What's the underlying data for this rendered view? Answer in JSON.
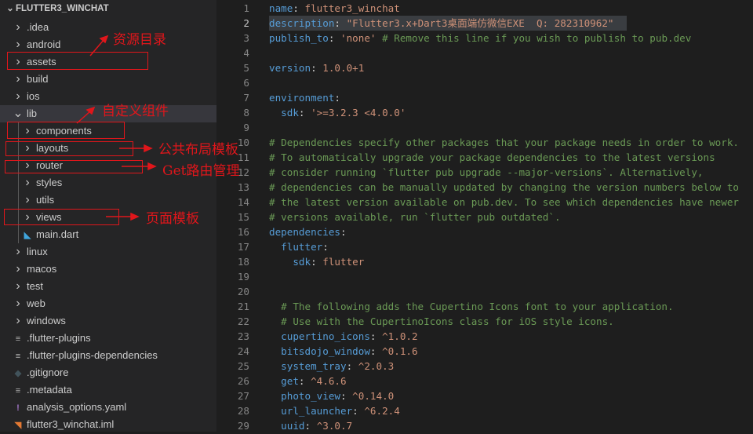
{
  "explorer": {
    "root": "FLUTTER3_WINCHAT",
    "items": [
      {
        "label": ".idea",
        "type": "folder",
        "depth": 0
      },
      {
        "label": "android",
        "type": "folder",
        "depth": 0
      },
      {
        "label": "assets",
        "type": "folder",
        "depth": 0
      },
      {
        "label": "build",
        "type": "folder",
        "depth": 0
      },
      {
        "label": "ios",
        "type": "folder",
        "depth": 0
      },
      {
        "label": "lib",
        "type": "folder-open",
        "depth": 0,
        "selected": true
      },
      {
        "label": "components",
        "type": "folder",
        "depth": 1
      },
      {
        "label": "layouts",
        "type": "folder",
        "depth": 1
      },
      {
        "label": "router",
        "type": "folder",
        "depth": 1
      },
      {
        "label": "styles",
        "type": "folder",
        "depth": 1
      },
      {
        "label": "utils",
        "type": "folder",
        "depth": 1
      },
      {
        "label": "views",
        "type": "folder",
        "depth": 1
      },
      {
        "label": "main.dart",
        "type": "dart-file",
        "depth": 1
      },
      {
        "label": "linux",
        "type": "folder",
        "depth": 0
      },
      {
        "label": "macos",
        "type": "folder",
        "depth": 0
      },
      {
        "label": "test",
        "type": "folder",
        "depth": 0
      },
      {
        "label": "web",
        "type": "folder",
        "depth": 0
      },
      {
        "label": "windows",
        "type": "folder",
        "depth": 0
      },
      {
        "label": ".flutter-plugins",
        "type": "text-file",
        "depth": 0
      },
      {
        "label": ".flutter-plugins-dependencies",
        "type": "text-file",
        "depth": 0
      },
      {
        "label": ".gitignore",
        "type": "git-file",
        "depth": 0
      },
      {
        "label": ".metadata",
        "type": "text-file",
        "depth": 0
      },
      {
        "label": "analysis_options.yaml",
        "type": "yaml-file",
        "depth": 0
      },
      {
        "label": "flutter3_winchat.iml",
        "type": "rss-file",
        "depth": 0
      }
    ]
  },
  "annotations": {
    "assets": "资源目录",
    "components": "自定义组件",
    "layouts": "公共布局模板",
    "router": "Get路由管理",
    "views": "页面模板"
  },
  "editor": {
    "current_line": 2,
    "lines": [
      [
        [
          "k",
          "name"
        ],
        [
          "p",
          ": "
        ],
        [
          "s",
          "flutter3_winchat"
        ]
      ],
      [
        [
          "k",
          "description"
        ],
        [
          "p",
          ": "
        ],
        [
          "s",
          "\"Flutter3.x+Dart3桌面端仿微信EXE  Q: 282310962\""
        ]
      ],
      [
        [
          "k",
          "publish_to"
        ],
        [
          "p",
          ": "
        ],
        [
          "s",
          "'none'"
        ],
        [
          "c",
          " # Remove this line if you wish to publish to pub.dev"
        ]
      ],
      [],
      [
        [
          "k",
          "version"
        ],
        [
          "p",
          ": "
        ],
        [
          "n",
          "1.0.0+1"
        ]
      ],
      [],
      [
        [
          "k",
          "environment"
        ],
        [
          "p",
          ":"
        ]
      ],
      [
        [
          "p",
          "  "
        ],
        [
          "k",
          "sdk"
        ],
        [
          "p",
          ": "
        ],
        [
          "s",
          "'>=3.2.3 <4.0.0'"
        ]
      ],
      [],
      [
        [
          "c",
          "# Dependencies specify other packages that your package needs in order to work."
        ]
      ],
      [
        [
          "c",
          "# To automatically upgrade your package dependencies to the latest versions"
        ]
      ],
      [
        [
          "c",
          "# consider running `flutter pub upgrade --major-versions`. Alternatively,"
        ]
      ],
      [
        [
          "c",
          "# dependencies can be manually updated by changing the version numbers below to"
        ]
      ],
      [
        [
          "c",
          "# the latest version available on pub.dev. To see which dependencies have newer"
        ]
      ],
      [
        [
          "c",
          "# versions available, run `flutter pub outdated`."
        ]
      ],
      [
        [
          "k",
          "dependencies"
        ],
        [
          "p",
          ":"
        ]
      ],
      [
        [
          "p",
          "  "
        ],
        [
          "k",
          "flutter"
        ],
        [
          "p",
          ":"
        ]
      ],
      [
        [
          "p",
          "    "
        ],
        [
          "k",
          "sdk"
        ],
        [
          "p",
          ": "
        ],
        [
          "s",
          "flutter"
        ]
      ],
      [],
      [],
      [
        [
          "c",
          "  # The following adds the Cupertino Icons font to your application."
        ]
      ],
      [
        [
          "c",
          "  # Use with the CupertinoIcons class for iOS style icons."
        ]
      ],
      [
        [
          "p",
          "  "
        ],
        [
          "k",
          "cupertino_icons"
        ],
        [
          "p",
          ": "
        ],
        [
          "n",
          "^1.0.2"
        ]
      ],
      [
        [
          "p",
          "  "
        ],
        [
          "k",
          "bitsdojo_window"
        ],
        [
          "p",
          ": "
        ],
        [
          "n",
          "^0.1.6"
        ]
      ],
      [
        [
          "p",
          "  "
        ],
        [
          "k",
          "system_tray"
        ],
        [
          "p",
          ": "
        ],
        [
          "n",
          "^2.0.3"
        ]
      ],
      [
        [
          "p",
          "  "
        ],
        [
          "k",
          "get"
        ],
        [
          "p",
          ": "
        ],
        [
          "n",
          "^4.6.6"
        ]
      ],
      [
        [
          "p",
          "  "
        ],
        [
          "k",
          "photo_view"
        ],
        [
          "p",
          ": "
        ],
        [
          "n",
          "^0.14.0"
        ]
      ],
      [
        [
          "p",
          "  "
        ],
        [
          "k",
          "url_launcher"
        ],
        [
          "p",
          ": "
        ],
        [
          "n",
          "^6.2.4"
        ]
      ],
      [
        [
          "p",
          "  "
        ],
        [
          "k",
          "uuid"
        ],
        [
          "p",
          ": "
        ],
        [
          "n",
          "^3.0.7"
        ]
      ]
    ]
  }
}
